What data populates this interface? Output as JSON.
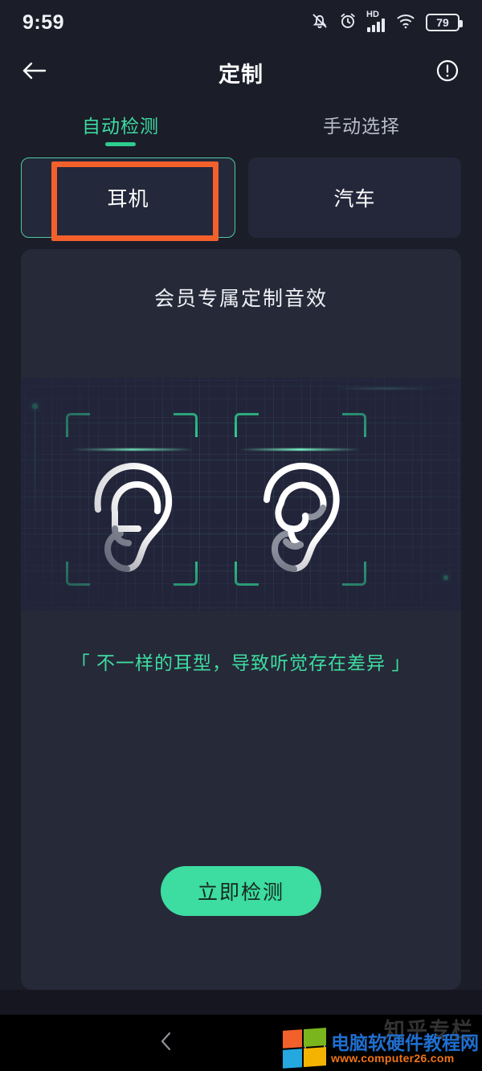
{
  "status_bar": {
    "time": "9:59",
    "battery_level": "79",
    "hd_label": "HD",
    "icons": [
      "bell-off-icon",
      "alarm-clock-icon",
      "hd-signal-icon",
      "wifi-icon",
      "battery-icon"
    ]
  },
  "app_bar": {
    "back_icon": "back-arrow-icon",
    "title": "定制",
    "info_icon": "info-circle-icon"
  },
  "tabs": [
    {
      "label": "自动检测",
      "active": true
    },
    {
      "label": "手动选择",
      "active": false
    }
  ],
  "chips": [
    {
      "label": "耳机",
      "selected": true
    },
    {
      "label": "汽车",
      "selected": false
    }
  ],
  "annotation": {
    "color": "#f2602c",
    "target": "耳机"
  },
  "card": {
    "title": "会员专属定制音效",
    "caption": "「 不一样的耳型，导致听觉存在差异 」",
    "cta_label": "立即检测",
    "scan_left_icon": "ear-left-icon",
    "scan_right_icon": "ear-right-icon"
  },
  "colors": {
    "accent_green": "#3ddca0",
    "bracket_green": "#2ecc8f",
    "annotation_orange": "#f2602c",
    "page_bg": "#1b1d29",
    "card_bg": "#262938"
  },
  "nav_bar": {
    "back_icon": "nav-back-icon",
    "home_icon": "nav-home-icon"
  },
  "watermark": {
    "site_name": "电脑软硬件教程网",
    "url": "www.computer26.com",
    "ghost_text": "知乎专栏"
  }
}
